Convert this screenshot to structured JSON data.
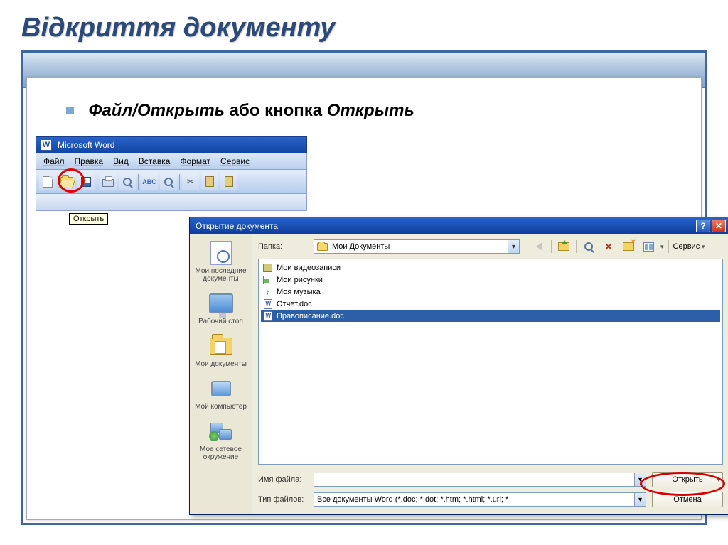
{
  "slide": {
    "title": "Відкриття документу",
    "bullet_italic1": "Файл/Открыть",
    "bullet_plain": " або кнопка ",
    "bullet_italic2": "Открыть"
  },
  "word": {
    "title": "Microsoft Word",
    "menu": [
      "Файл",
      "Правка",
      "Вид",
      "Вставка",
      "Формат",
      "Сервис"
    ],
    "tooltip": "Открыть"
  },
  "dialog": {
    "title": "Открытие документа",
    "folder_label": "Папка:",
    "folder_value": "Мои Документы",
    "service_label": "Сервис",
    "places": [
      {
        "label": "Мои последние документы"
      },
      {
        "label": "Рабочий стол"
      },
      {
        "label": "Мои документы"
      },
      {
        "label": "Мой компьютер"
      },
      {
        "label": "Мое сетевое окружение"
      }
    ],
    "files": [
      {
        "icon": "film",
        "name": "Мои видеозаписи"
      },
      {
        "icon": "pic",
        "name": "Мои рисунки"
      },
      {
        "icon": "music",
        "name": "Моя музыка"
      },
      {
        "icon": "doc",
        "name": "Отчет.doc"
      },
      {
        "icon": "doc",
        "name": "Правописание.doc",
        "selected": true
      }
    ],
    "filename_label": "Имя файла:",
    "filename_value": "",
    "filetype_label": "Тип файлов:",
    "filetype_value": "Все документы Word (*.doc; *.dot; *.htm; *.html; *.url; *",
    "open_btn": "Открыть",
    "cancel_btn": "Отмена"
  }
}
